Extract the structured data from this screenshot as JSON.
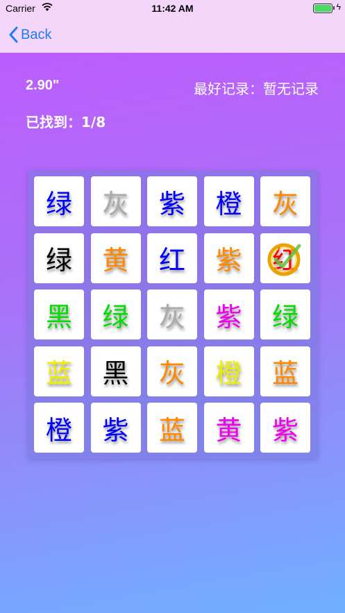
{
  "status_bar": {
    "carrier": "Carrier",
    "time": "11:42 AM"
  },
  "nav": {
    "back_label": "Back"
  },
  "stats": {
    "elapsed": "2.90\"",
    "best": "最好记录：暂无记录",
    "found": "已找到：1/8"
  },
  "grid": [
    [
      {
        "char": "绿",
        "color": "#0000ff"
      },
      {
        "char": "灰",
        "color": "#aaaaaa"
      },
      {
        "char": "紫",
        "color": "#0000ff"
      },
      {
        "char": "橙",
        "color": "#0000ff"
      },
      {
        "char": "灰",
        "color": "#ff8800"
      }
    ],
    [
      {
        "char": "绿",
        "color": "#000000"
      },
      {
        "char": "黄",
        "color": "#ff8800"
      },
      {
        "char": "红",
        "color": "#0000ff"
      },
      {
        "char": "紫",
        "color": "#ff8800"
      },
      {
        "char": "红",
        "color": "#ff0000",
        "found": true
      }
    ],
    [
      {
        "char": "黑",
        "color": "#00dd00"
      },
      {
        "char": "绿",
        "color": "#00dd00"
      },
      {
        "char": "灰",
        "color": "#aaaaaa"
      },
      {
        "char": "紫",
        "color": "#ee00ee"
      },
      {
        "char": "绿",
        "color": "#00dd00"
      }
    ],
    [
      {
        "char": "蓝",
        "color": "#eeee00"
      },
      {
        "char": "黑",
        "color": "#000000"
      },
      {
        "char": "灰",
        "color": "#ff8800"
      },
      {
        "char": "橙",
        "color": "#eeee00"
      },
      {
        "char": "蓝",
        "color": "#ff8800"
      }
    ],
    [
      {
        "char": "橙",
        "color": "#0000ff"
      },
      {
        "char": "紫",
        "color": "#0000ff"
      },
      {
        "char": "蓝",
        "color": "#ff8800"
      },
      {
        "char": "黄",
        "color": "#ee00ee"
      },
      {
        "char": "紫",
        "color": "#ee00ee"
      }
    ]
  ]
}
